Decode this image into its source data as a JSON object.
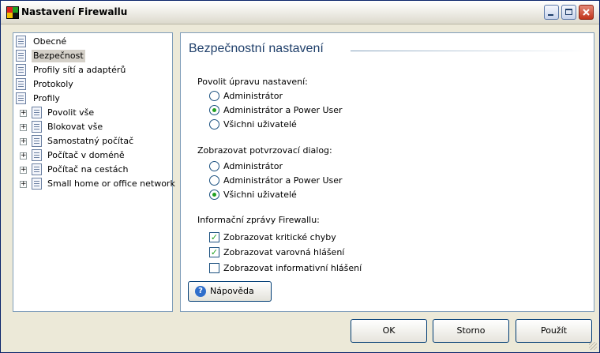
{
  "window": {
    "title": "Nastavení Firewallu",
    "controls": [
      "minimize",
      "maximize",
      "close"
    ]
  },
  "tree": {
    "top_items": [
      "Obecné",
      "Bezpečnost",
      "Profily sítí a adaptérů",
      "Protokoly",
      "Profily"
    ],
    "selected": "Bezpečnost",
    "profiles": [
      "Povolit vše",
      "Blokovat vše",
      "Samostatný počítač",
      "Počítač v doméně",
      "Počítač na cestách",
      "Small home or office network"
    ]
  },
  "panel": {
    "title": "Bezpečnostní nastavení",
    "group1": {
      "label": "Povolit úpravu nastavení:",
      "options": [
        "Administrátor",
        "Administrátor a Power User",
        "Všichni uživatelé"
      ],
      "selected": 1
    },
    "group2": {
      "label": "Zobrazovat potvrzovací dialog:",
      "options": [
        "Administrátor",
        "Administrátor a Power User",
        "Všichni uživatelé"
      ],
      "selected": 2
    },
    "group3": {
      "label": "Informační zprávy Firewallu:",
      "checks": [
        {
          "label": "Zobrazovat kritické chyby",
          "checked": true
        },
        {
          "label": "Zobrazovat varovná hlášení",
          "checked": true
        },
        {
          "label": "Zobrazovat informativní hlášení",
          "checked": false
        }
      ]
    },
    "help_button": "Nápověda"
  },
  "buttons": {
    "ok": "OK",
    "cancel": "Storno",
    "apply": "Použít"
  },
  "colors": {
    "title_text": "#1f3f6a",
    "radio_check": "#21a121",
    "selection": "#d4d0c8"
  }
}
